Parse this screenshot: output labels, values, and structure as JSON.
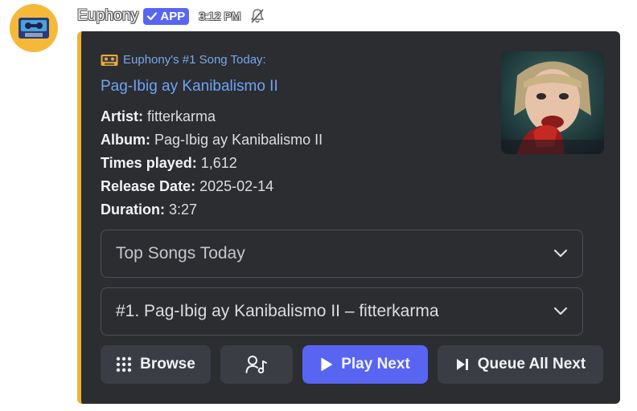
{
  "message": {
    "username": "Euphony",
    "app_badge": "APP",
    "timestamp": "3:12 PM"
  },
  "embed": {
    "accent_color": "#f0b232",
    "author": "Euphony's #1 Song Today:",
    "title": "Pag-Ibig ay Kanibalismo II",
    "fields": [
      {
        "key": "Artist:",
        "value": "fitterkarma"
      },
      {
        "key": "Album:",
        "value": "Pag-Ibig ay Kanibalismo II"
      },
      {
        "key": "Times played:",
        "value": "1,612"
      },
      {
        "key": "Release Date:",
        "value": "2025-02-14"
      },
      {
        "key": "Duration:",
        "value": "3:27"
      }
    ]
  },
  "selects": [
    {
      "text": "Top Songs Today",
      "icon": "chevron-down-icon"
    },
    {
      "text": "#1. Pag-Ibig ay Kanibalismo II – fitterkarma",
      "icon": "chevron-down-icon"
    }
  ],
  "buttons": {
    "browse": "Browse",
    "play_next": "Play Next",
    "queue_all_next": "Queue All Next"
  },
  "colors": {
    "brand": "#5865f2",
    "embed_bg": "#2b2d31",
    "link": "#6ea3f5"
  }
}
